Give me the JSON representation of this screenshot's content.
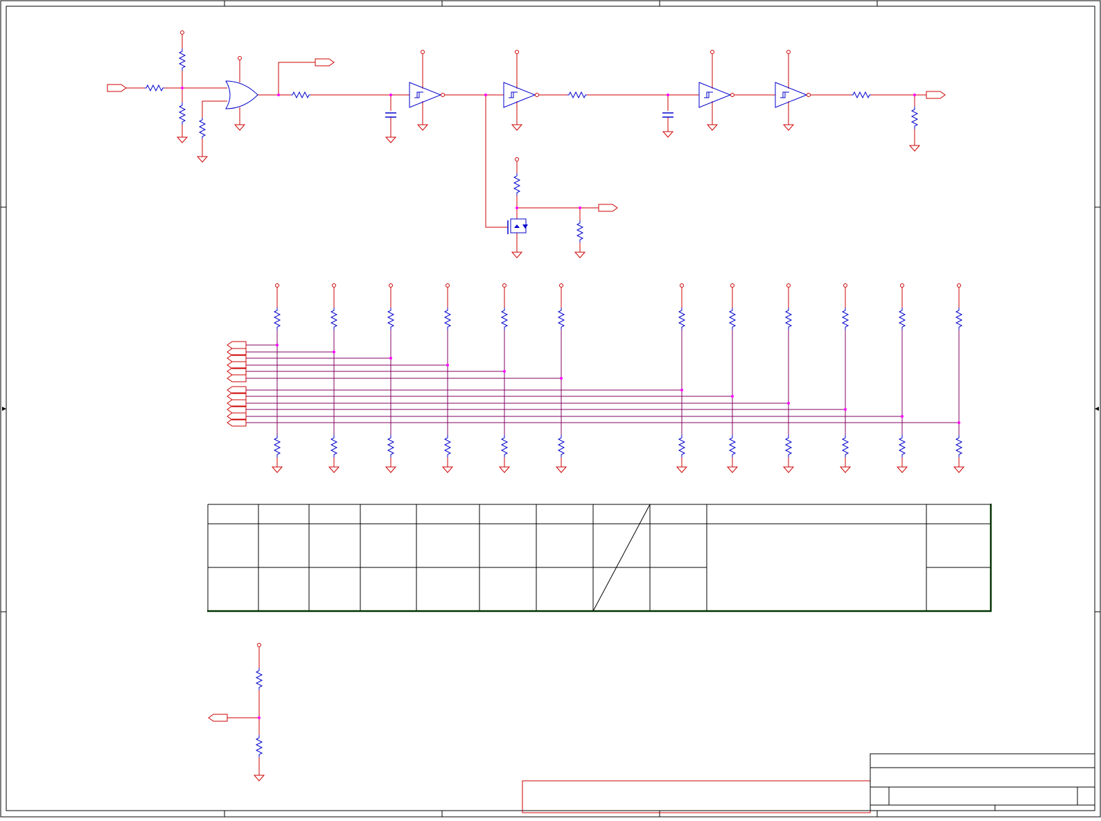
{
  "sheet": {
    "zone_columns": [
      "",
      "",
      "",
      "",
      ""
    ],
    "zone_rows": [
      "",
      "",
      "",
      ""
    ]
  },
  "schematic": {
    "port_labels": [],
    "net_labels": [],
    "ref_designators": [],
    "component_values": []
  },
  "revision_table": {
    "headers": [
      "",
      "",
      "",
      "",
      "",
      "",
      "",
      "",
      "",
      "",
      ""
    ],
    "rows": [
      [
        "",
        "",
        "",
        "",
        "",
        "",
        "",
        "",
        "",
        "",
        ""
      ],
      [
        "",
        "",
        "",
        "",
        "",
        "",
        "",
        "",
        "",
        "",
        ""
      ]
    ]
  },
  "title_block": {
    "title": "",
    "company": "",
    "document_number": "",
    "revision": "",
    "size": "",
    "sheet": "",
    "date": ""
  },
  "colors": {
    "wire": "#cc0000",
    "bus_wire": "#800060",
    "component": "#0000cc",
    "junction": "#ff00ff",
    "border": "#000000",
    "table_border": "#003300"
  }
}
